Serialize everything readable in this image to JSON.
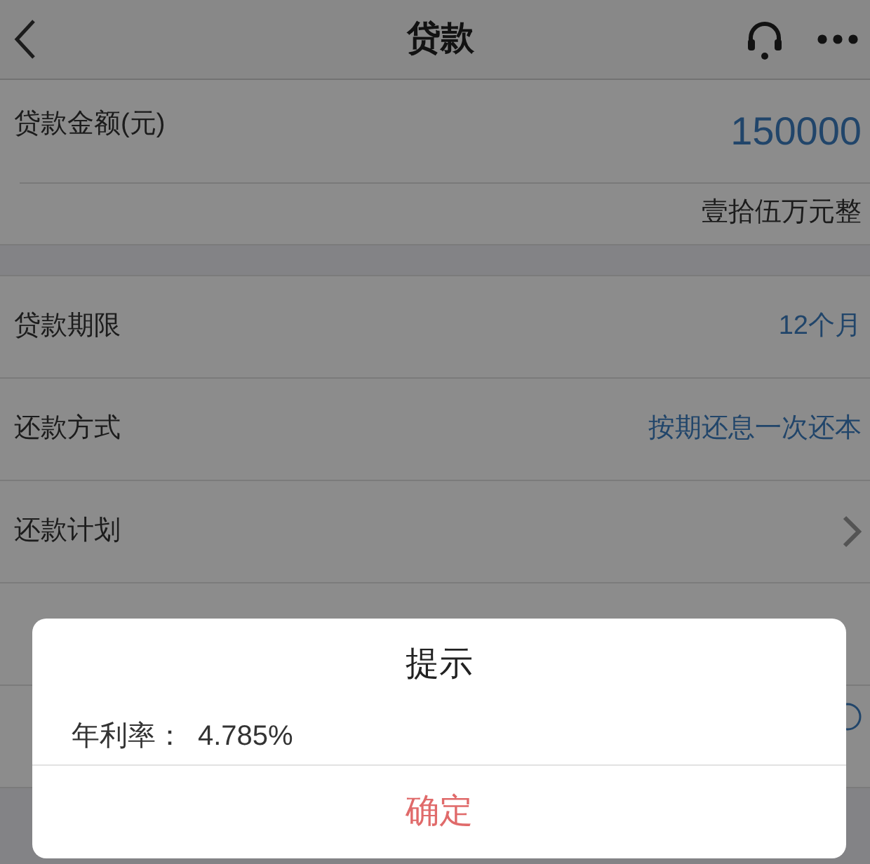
{
  "header": {
    "title": "贷款"
  },
  "amount": {
    "label": "贷款金额(元)",
    "value": "150000",
    "in_words": "壹拾伍万元整"
  },
  "rows": [
    {
      "label": "贷款期限",
      "value": "12个月",
      "kind": "value"
    },
    {
      "label": "还款方式",
      "value": "按期还息一次还本",
      "kind": "value"
    },
    {
      "label": "还款计划",
      "kind": "link"
    },
    {
      "kind": "blank"
    },
    {
      "kind": "info"
    }
  ],
  "dialog": {
    "title": "提示",
    "label": "年利率：",
    "rate": "4.785%",
    "button": "确定"
  }
}
